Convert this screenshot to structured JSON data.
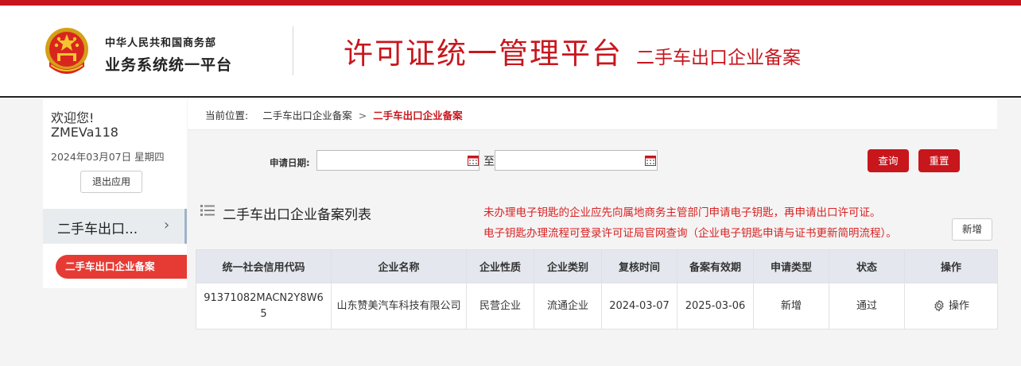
{
  "header": {
    "ministry_name": "中华人民共和国商务部",
    "ministry_sub": "业务系统统一平台",
    "platform_title": "许可证统一管理平台",
    "platform_sub": "二手车出口企业备案",
    "brand_color": "#c8161d"
  },
  "sidebar": {
    "welcome": "欢迎您!",
    "username": "ZMEVa118",
    "date": "2024年03月07日 星期四",
    "logout_label": "退出应用",
    "menu_item_label": "二手车出口...",
    "submenu_active_label": "二手车出口企业备案"
  },
  "breadcrumb": {
    "prefix": "当前位置:",
    "parent": "二手车出口企业备案",
    "separator": ">",
    "current": "二手车出口企业备案"
  },
  "filter": {
    "apply_date_label": "申请日期:",
    "date_from_value": "",
    "date_to_value": "",
    "to_label": "至",
    "query_label": "查询",
    "reset_label": "重置"
  },
  "list": {
    "title": "二手车出口企业备案列表",
    "notice_line1": "未办理电子钥匙的企业应先向属地商务主管部门申请电子钥匙，再申请出口许可证。",
    "notice_line2": "电子钥匙办理流程可登录许可证局官网查询（企业电子钥匙申请与证书更新简明流程）。",
    "add_label": "新增"
  },
  "table": {
    "columns": [
      "统一社会信用代码",
      "企业名称",
      "企业性质",
      "企业类别",
      "复核时间",
      "备案有效期",
      "申请类型",
      "状态",
      "操作"
    ],
    "rows": [
      {
        "credit_code": "91371082MACN2Y8W65",
        "company_name": "山东赞美汽车科技有限公司",
        "nature": "民营企业",
        "category": "流通企业",
        "review_date": "2024-03-07",
        "valid_until": "2025-03-06",
        "apply_type": "新增",
        "status": "通过",
        "action_label": "操作",
        "action_icon": "gear-icon"
      }
    ]
  }
}
